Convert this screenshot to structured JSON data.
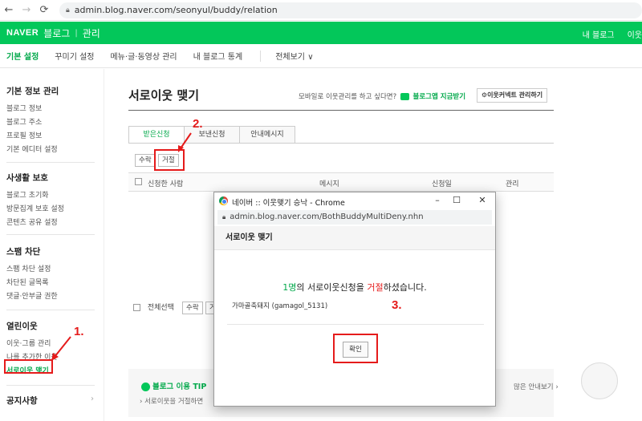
{
  "browser": {
    "url": "admin.blog.naver.com/seonyul/buddy/relation"
  },
  "header": {
    "logo": "NAVER",
    "title": "블로그",
    "section": "관리",
    "my_blog": "내 블로그",
    "neighbor": "이웃"
  },
  "tabs": [
    "기본 설정",
    "꾸미기 설정",
    "메뉴·글·동영상 관리",
    "내 블로그 통계",
    "전체보기"
  ],
  "sidebar": {
    "groups": [
      {
        "title": "기본 정보 관리",
        "items": [
          "블로그 정보",
          "블로그 주소",
          "프로필 정보",
          "기본 에디터 설정"
        ]
      },
      {
        "title": "사생활 보호",
        "items": [
          "블로그 초기화",
          "방문집계 보호 설정",
          "콘텐츠 공유 설정"
        ]
      },
      {
        "title": "스팸 차단",
        "items": [
          "스팸 차단 설정",
          "차단된 글목록",
          "댓글·안부글 권한"
        ]
      },
      {
        "title": "열린이웃",
        "items": [
          "이웃·그룹 관리",
          "나를 추가한 이웃",
          "서로이웃 맺기"
        ]
      }
    ],
    "notice": "공지사항"
  },
  "main": {
    "title": "서로이웃 맺기",
    "mobile_text": "모바일로 이웃관리를 하고 싶다면?",
    "app_link": "블로그앱 지금받기",
    "manage_button": "이웃커넥트 관리하기",
    "subtabs": [
      "받은신청",
      "보낸신청",
      "안내메시지"
    ],
    "accept": "수락",
    "reject": "거절",
    "columns": [
      "신청한 사람",
      "메시지",
      "신청일",
      "관리"
    ],
    "select_all": "전체선택",
    "tip_title": "블로그 이용 TIP",
    "tip_text": "서로이웃을 거절하면",
    "tip_right": "많은 안내보기"
  },
  "annotations": [
    "1.",
    "2.",
    "3."
  ],
  "popup": {
    "title": "네이버 :: 이웃맺기 승낙 - Chrome",
    "url": "admin.blog.naver.com/BothBuddyMultiDeny.nhn",
    "header": "서로이웃 맺기",
    "msg_count": "1명",
    "msg_part1": "의 서로이웃신청을",
    "msg_reject": "거절",
    "msg_part2": "하셨습니다.",
    "name": "가마골축돼지 (gamagol_5131)",
    "confirm": "확인"
  },
  "colors": {
    "brand_green": "#03c75a",
    "annotation_red": "#e51b1b"
  }
}
